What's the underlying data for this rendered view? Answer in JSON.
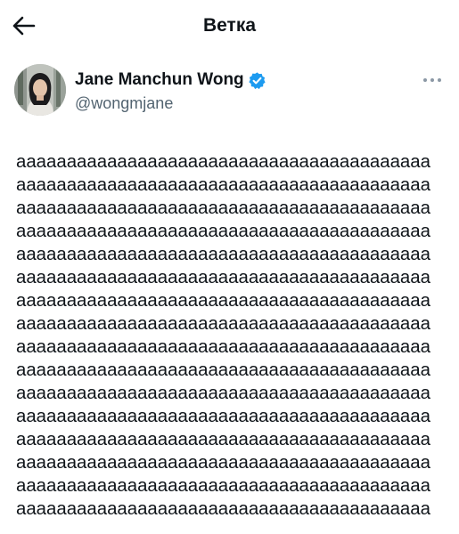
{
  "header": {
    "title": "Ветка",
    "back_icon": "arrow-left-icon"
  },
  "author": {
    "display_name": "Jane Manchun Wong",
    "handle": "@wongmjane",
    "verified": true,
    "verified_icon": "verified-badge-icon",
    "verified_color": "#1d9bf0",
    "more_icon": "more-horizontal-icon"
  },
  "tweet": {
    "lines": [
      "aaaaaaaaaaaaaaaaaaaaaaaaaaaaaaaaaaaaaaaaa",
      "aaaaaaaaaaaaaaaaaaaaaaaaaaaaaaaaaaaaaaaaa",
      "aaaaaaaaaaaaaaaaaaaaaaaaaaaaaaaaaaaaaaaaa",
      "aaaaaaaaaaaaaaaaaaaaaaaaaaaaaaaaaaaaaaaaa",
      "aaaaaaaaaaaaaaaaaaaaaaaaaaaaaaaaaaaaaaaaa",
      "aaaaaaaaaaaaaaaaaaaaaaaaaaaaaaaaaaaaaaaaa",
      "aaaaaaaaaaaaaaaaaaaaaaaaaaaaaaaaaaaaaaaaa",
      "aaaaaaaaaaaaaaaaaaaaaaaaaaaaaaaaaaaaaaaaa",
      "aaaaaaaaaaaaaaaaaaaaaaaaaaaaaaaaaaaaaaaaa",
      "aaaaaaaaaaaaaaaaaaaaaaaaaaaaaaaaaaaaaaaaa",
      "aaaaaaaaaaaaaaaaaaaaaaaaaaaaaaaaaaaaaaaaa",
      "aaaaaaaaaaaaaaaaaaaaaaaaaaaaaaaaaaaaaaaaa",
      "aaaaaaaaaaaaaaaaaaaaaaaaaaaaaaaaaaaaaaaaa",
      "aaaaaaaaaaaaaaaaaaaaaaaaaaaaaaaaaaaaaaaaa",
      "aaaaaaaaaaaaaaaaaaaaaaaaaaaaaaaaaaaaaaaaa",
      "aaaaaaaaaaaaaaaaaaaaaaaaaaaaaaaaaaaaaaaaa"
    ]
  },
  "colors": {
    "text_primary": "#0f1419",
    "text_secondary": "#536471",
    "background": "#ffffff"
  }
}
